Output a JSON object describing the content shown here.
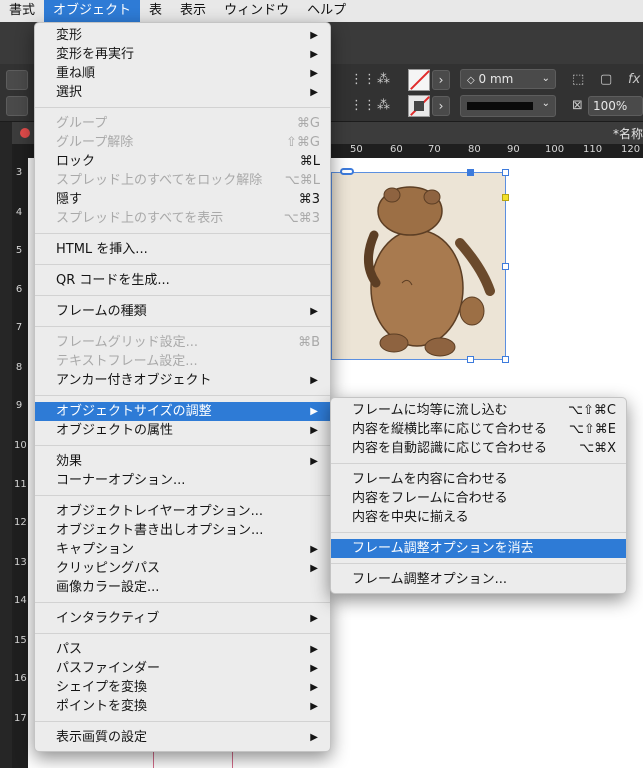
{
  "menubar": [
    "書式",
    "オブジェクト",
    "表",
    "表示",
    "ウィンドウ",
    "ヘルプ"
  ],
  "document": {
    "title": "*名称"
  },
  "ruler": {
    "h": [
      "50",
      "60",
      "70",
      "80",
      "90",
      "100",
      "110",
      "120"
    ],
    "v": [
      "3",
      "4",
      "5",
      "6",
      "7",
      "8",
      "9",
      "10",
      "11",
      "12",
      "13",
      "14",
      "15",
      "16",
      "17"
    ]
  },
  "control": {
    "stroke_weight": "0 mm",
    "zoom": "100%",
    "fx": "fx"
  },
  "main_menu": [
    {
      "label": "変形",
      "arrow": true
    },
    {
      "label": "変形を再実行",
      "arrow": true
    },
    {
      "label": "重ね順",
      "arrow": true
    },
    {
      "label": "選択",
      "arrow": true
    },
    {
      "label": "グループ",
      "shortcut": "⌘G",
      "disabled": true
    },
    {
      "label": "グループ解除",
      "shortcut": "⇧⌘G",
      "disabled": true
    },
    {
      "label": "ロック",
      "shortcut": "⌘L"
    },
    {
      "label": "スプレッド上のすべてをロック解除",
      "shortcut": "⌥⌘L",
      "disabled": true
    },
    {
      "label": "隠す",
      "shortcut": "⌘3"
    },
    {
      "label": "スプレッド上のすべてを表示",
      "shortcut": "⌥⌘3",
      "disabled": true
    },
    {
      "label": "HTML を挿入..."
    },
    {
      "label": "QR コードを生成..."
    },
    {
      "label": "フレームの種類",
      "arrow": true
    },
    {
      "label": "フレームグリッド設定...",
      "shortcut": "⌘B",
      "disabled": true
    },
    {
      "label": "テキストフレーム設定...",
      "disabled": true
    },
    {
      "label": "アンカー付きオブジェクト",
      "arrow": true
    },
    {
      "label": "オブジェクトサイズの調整",
      "arrow": true,
      "highlighted": true
    },
    {
      "label": "オブジェクトの属性",
      "arrow": true
    },
    {
      "label": "効果",
      "arrow": true
    },
    {
      "label": "コーナーオプション..."
    },
    {
      "label": "オブジェクトレイヤーオプション..."
    },
    {
      "label": "オブジェクト書き出しオプション..."
    },
    {
      "label": "キャプション",
      "arrow": true
    },
    {
      "label": "クリッピングパス",
      "arrow": true
    },
    {
      "label": "画像カラー設定..."
    },
    {
      "label": "インタラクティブ",
      "arrow": true
    },
    {
      "label": "パス",
      "arrow": true
    },
    {
      "label": "パスファインダー",
      "arrow": true
    },
    {
      "label": "シェイプを変換",
      "arrow": true
    },
    {
      "label": "ポイントを変換",
      "arrow": true
    },
    {
      "label": "表示画質の設定",
      "arrow": true
    }
  ],
  "sub_menu": [
    {
      "label": "フレームに均等に流し込む",
      "shortcut": "⌥⇧⌘C"
    },
    {
      "label": "内容を縦横比率に応じて合わせる",
      "shortcut": "⌥⇧⌘E"
    },
    {
      "label": "内容を自動認識に応じて合わせる",
      "shortcut": "⌥⌘X"
    },
    {
      "label": "フレームを内容に合わせる"
    },
    {
      "label": "内容をフレームに合わせる"
    },
    {
      "label": "内容を中央に揃える"
    },
    {
      "label": "フレーム調整オプションを消去",
      "highlighted": true
    },
    {
      "label": "フレーム調整オプション..."
    }
  ],
  "colors": {
    "highlight": "#2e7bd6",
    "menu_bg": "#ececec",
    "disabled": "#a9a9a9"
  }
}
